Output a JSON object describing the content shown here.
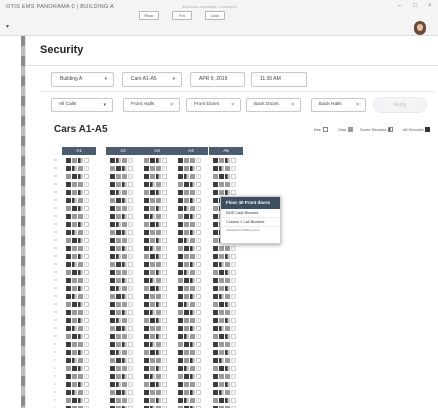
{
  "app": {
    "title": "OTIS EMS PANORAMA 0 | BUILDING A",
    "company": "BUILDING PROPERTY COMPANY",
    "toolbar": [
      "Rsvc",
      "Frn",
      "Lock"
    ],
    "window_controls": [
      "–",
      "□",
      "×"
    ]
  },
  "page": {
    "title": "Security"
  },
  "filters": {
    "building": "Building A",
    "cars": "Cars A1-A5",
    "date": "APR 9, 2019",
    "time": "11:30 AM"
  },
  "chips": [
    {
      "label": "All Calls"
    },
    {
      "label": "Front Halls"
    },
    {
      "label": "Front Doors"
    },
    {
      "label": "Back Doors"
    },
    {
      "label": "Back Halls"
    }
  ],
  "apply_label": "Apply",
  "section": {
    "title": "Cars A1-A5"
  },
  "legend": {
    "free_label": "free",
    "open_label": "Own",
    "some_label": "Some Secured",
    "all_label": "All Secured"
  },
  "cars": [
    "A1",
    "A2",
    "A3",
    "A4",
    "A5"
  ],
  "floors": [
    "32",
    "31",
    "30",
    "29",
    "28",
    "27",
    "26",
    "25",
    "24",
    "23",
    "22",
    "21",
    "20",
    "19",
    "18",
    "17",
    "16",
    "15",
    "14",
    "13",
    "12",
    "11",
    "10",
    "9",
    "8",
    "7",
    "6",
    "5",
    "4",
    "3",
    "2",
    "1",
    "B"
  ],
  "popover": {
    "title": "Floor 40 Front doors",
    "items": [
      "EMS Calls Blocked",
      "Custom 1 Call Blocked"
    ],
    "note": "Scheduled by Building Admin"
  },
  "colors": {
    "header": "#4c5e6e",
    "popover_header": "#3e4f5f",
    "stripe": "#8a8a8a"
  }
}
